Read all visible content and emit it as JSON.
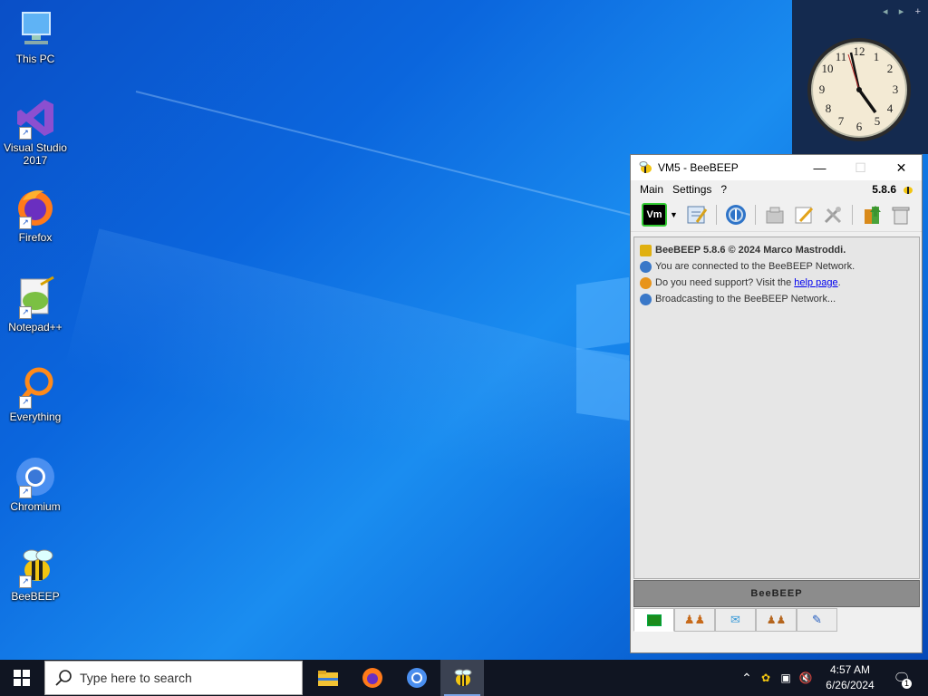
{
  "desktop": {
    "icons": [
      {
        "label": "This PC"
      },
      {
        "label": "Visual Studio 2017"
      },
      {
        "label": "Firefox"
      },
      {
        "label": "Notepad++"
      },
      {
        "label": "Everything"
      },
      {
        "label": "Chromium"
      },
      {
        "label": "BeeBEEP"
      }
    ],
    "gadget": {
      "nav_prev": "◂",
      "nav_next": "▸",
      "add": "+"
    }
  },
  "beebeep": {
    "title": "VM5 - BeeBEEP",
    "version": "5.8.6",
    "menu": [
      "Main",
      "Settings",
      "?"
    ],
    "status_label": "Vm",
    "messages": [
      {
        "text": "BeeBEEP 5.8.6 © 2024 Marco Mastroddi.",
        "icon": "bee-icon",
        "color": "#e0b010"
      },
      {
        "text": "You are connected to the BeeBEEP Network.",
        "icon": "network-icon",
        "color": "#3a78c8"
      },
      {
        "text_before": "Do you need support? Visit the ",
        "link": "help page",
        "text_after": ".",
        "icon": "support-icon",
        "color": "#e8941a"
      },
      {
        "text": "Broadcasting to the BeeBEEP Network...",
        "icon": "broadcast-icon",
        "color": "#3a78c8"
      }
    ],
    "banner": "BeeBEEP"
  },
  "taskbar": {
    "search_placeholder": "Type here to search",
    "time": "4:57 AM",
    "date": "6/26/2024",
    "notification_count": "1"
  }
}
